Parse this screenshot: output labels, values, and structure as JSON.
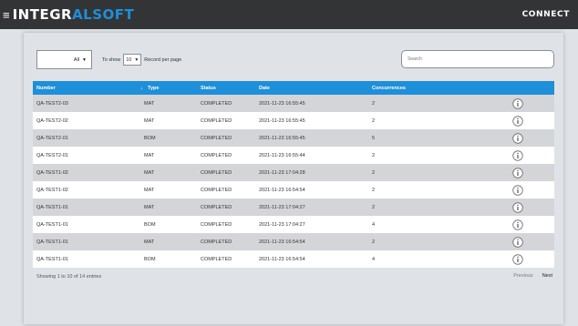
{
  "navbar": {
    "menu_glyph": "≡",
    "logo_part1": "INTEGR",
    "logo_part2": "ALSOFT",
    "product": "CONNECT"
  },
  "controls": {
    "filter_value": "All",
    "to_show_label": "To show",
    "page_size_value": "10",
    "per_page_label": "Record per page",
    "search_placeholder": "Search"
  },
  "table": {
    "columns": [
      "Number",
      "Type",
      "Status",
      "Date",
      "Concurrences"
    ],
    "rows": [
      {
        "number": "QA-TEST2-03",
        "type": "MAT",
        "status": "COMPLETED",
        "date": "2021-11-23 16:55:45",
        "concurrences": "2"
      },
      {
        "number": "QA-TEST2-02",
        "type": "MAT",
        "status": "COMPLETED",
        "date": "2021-11-23 16:55:45",
        "concurrences": "2"
      },
      {
        "number": "QA-TEST2-01",
        "type": "BOM",
        "status": "COMPLETED",
        "date": "2021-11-23 16:55:45",
        "concurrences": "5"
      },
      {
        "number": "QA-TEST2-01",
        "type": "MAT",
        "status": "COMPLETED",
        "date": "2021-11-23 16:55:44",
        "concurrences": "2"
      },
      {
        "number": "QA-TEST1-02",
        "type": "MAT",
        "status": "COMPLETED",
        "date": "2021-11-23 17:04:28",
        "concurrences": "2"
      },
      {
        "number": "QA-TEST1-02",
        "type": "MAT",
        "status": "COMPLETED",
        "date": "2021-11-23 16:54:54",
        "concurrences": "2"
      },
      {
        "number": "QA-TEST1-01",
        "type": "MAT",
        "status": "COMPLETED",
        "date": "2021-11-23 17:04:27",
        "concurrences": "2"
      },
      {
        "number": "QA-TEST1-01",
        "type": "BOM",
        "status": "COMPLETED",
        "date": "2021-11-23 17:04:27",
        "concurrences": "4"
      },
      {
        "number": "QA-TEST1-01",
        "type": "MAT",
        "status": "COMPLETED",
        "date": "2021-11-23 16:54:54",
        "concurrences": "2"
      },
      {
        "number": "QA-TEST1-01",
        "type": "BOM",
        "status": "COMPLETED",
        "date": "2021-11-23 16:54:54",
        "concurrences": "4"
      }
    ],
    "row_action_icon": "info-icon"
  },
  "footer": {
    "info": "Showing 1 to 10 of 14 entries",
    "previous_label": "Previous",
    "next_label": "Next"
  },
  "colors": {
    "navbar": "#333436",
    "accent": "#1e8fd9",
    "background": "#dfe3e8",
    "row_shaded": "#d3d5d9"
  }
}
